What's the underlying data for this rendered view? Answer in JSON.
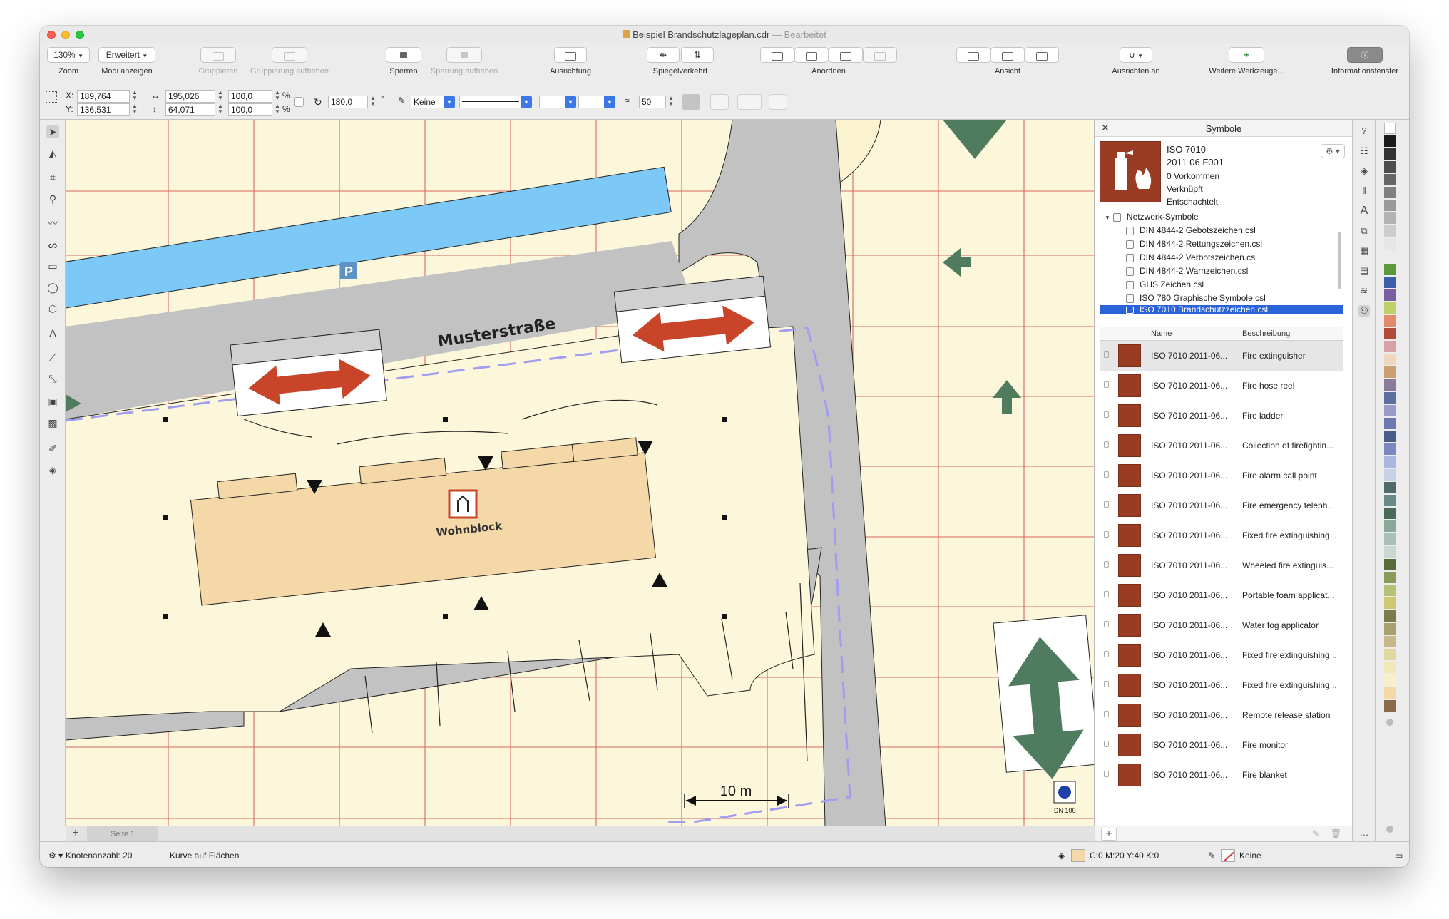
{
  "window": {
    "title": "Beispiel Brandschutzlageplan.cdr",
    "separator": "—",
    "state": "Bearbeitet"
  },
  "toolbar": {
    "zoom_value": "130%",
    "zoom_caption": "Zoom",
    "mode_value": "Erweitert",
    "mode_caption": "Modi anzeigen",
    "group_caption": "Gruppieren",
    "ungroup_caption": "Gruppierung aufheben",
    "lock_caption": "Sperren",
    "unlock_caption": "Sperrung aufheben",
    "align_caption": "Ausrichtung",
    "mirror_caption": "Spiegelverkehrt",
    "arrange_caption": "Anordnen",
    "view_caption": "Ansicht",
    "snap_caption": "Ausrichten an",
    "more_tools_caption": "Weitere Werkzeuge...",
    "info_caption": "Informationsfenster"
  },
  "properties": {
    "x_label": "X:",
    "x_value": "189,764",
    "y_label": "Y:",
    "y_value": "136,531",
    "width_value": "195,026",
    "height_value": "64,071",
    "scale_x": "100,0",
    "scale_y": "100,0",
    "percent": "%",
    "rotation": "180,0",
    "degree": "°",
    "outline": "Keine",
    "smoothing": "50"
  },
  "canvas": {
    "street_label": "Musterstraße",
    "building_label": "Wohnblock",
    "parking_label": "P",
    "scale_label": "10 m",
    "hydrant_label": "DN 100"
  },
  "pages": {
    "tab": "Seite 1"
  },
  "status": {
    "nodes": "Knotenanzahl: 20",
    "object": "Kurve auf Flächen",
    "fill": "C:0 M:20 Y:40 K:0",
    "outline": "Keine"
  },
  "docker": {
    "title": "Symbole",
    "symbol_title": "ISO 7010",
    "symbol_code": "2011-06 F001",
    "occurrences": "0 Vorkommen",
    "linked": "Verknüpft",
    "nested": "Entschachtelt",
    "col_name": "Name",
    "col_desc": "Beschreibung",
    "tree": [
      {
        "label": "Netzwerk-Symbole"
      },
      {
        "label": "DIN 4844-2 Gebotszeichen.csl"
      },
      {
        "label": "DIN 4844-2 Rettungszeichen.csl"
      },
      {
        "label": "DIN 4844-2 Verbotszeichen.csl"
      },
      {
        "label": "DIN 4844-2 Warnzeichen.csl"
      },
      {
        "label": "GHS Zeichen.csl"
      },
      {
        "label": "ISO 780 Graphische Symbole.csl"
      },
      {
        "label": "ISO 7010 Brandschutzzeichen.csl"
      }
    ],
    "symbols": [
      {
        "name": "ISO 7010 2011-06...",
        "desc": "Fire extinguisher"
      },
      {
        "name": "ISO 7010 2011-06...",
        "desc": "Fire hose reel"
      },
      {
        "name": "ISO 7010 2011-06...",
        "desc": "Fire ladder"
      },
      {
        "name": "ISO 7010 2011-06...",
        "desc": "Collection of firefightin..."
      },
      {
        "name": "ISO 7010 2011-06...",
        "desc": "Fire alarm call point"
      },
      {
        "name": "ISO 7010 2011-06...",
        "desc": "Fire emergency teleph..."
      },
      {
        "name": "ISO 7010 2011-06...",
        "desc": "Fixed fire extinguishing..."
      },
      {
        "name": "ISO 7010 2011-06...",
        "desc": "Wheeled fire extinguis..."
      },
      {
        "name": "ISO 7010 2011-06...",
        "desc": "Portable foam applicat..."
      },
      {
        "name": "ISO 7010 2011-06...",
        "desc": "Water fog applicator"
      },
      {
        "name": "ISO 7010 2011-06...",
        "desc": "Fixed fire extinguishing..."
      },
      {
        "name": "ISO 7010 2011-06...",
        "desc": "Fixed fire extinguishing..."
      },
      {
        "name": "ISO 7010 2011-06...",
        "desc": "Remote release station"
      },
      {
        "name": "ISO 7010 2011-06...",
        "desc": "Fire monitor"
      },
      {
        "name": "ISO 7010 2011-06...",
        "desc": "Fire blanket"
      }
    ]
  },
  "colors": {
    "accent": "#2962d9",
    "canvas_bg": "#fcf6db",
    "road": "#c2c2c2",
    "parking": "#7cc8f6",
    "building": "#f4d8a8",
    "red_arrow": "#c8452a",
    "green_arrow": "#4f7c5e",
    "symbol_brown": "#9a3c23"
  }
}
